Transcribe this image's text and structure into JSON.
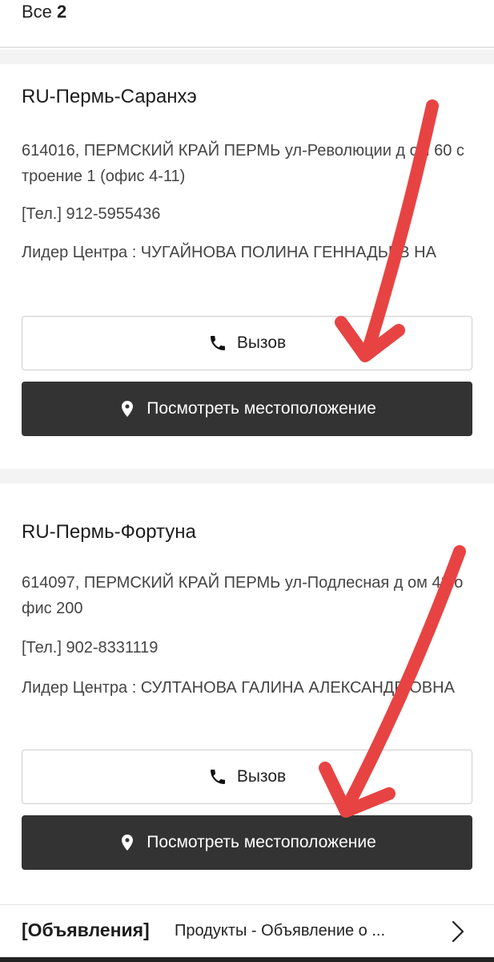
{
  "list_header": {
    "label": "Все",
    "count": "2"
  },
  "centers": [
    {
      "name": "RU-Пермь-Саранхэ",
      "address": "614016, ПЕРМСКИЙ КРАЙ ПЕРМЬ ул-Революции д ом 60 строение 1 (офис 4-11)",
      "phone": "[Тел.] 912-5955436",
      "leader": "Лидер Центра : ЧУГАЙНОВА ПОЛИНА ГЕННАДЬЕВ НА",
      "call_label": "Вызов",
      "location_label": "Посмотреть местоположение"
    },
    {
      "name": "RU-Пермь-Фортуна",
      "address": "614097, ПЕРМСКИЙ КРАЙ ПЕРМЬ ул-Подлесная д ом 43 офис 200",
      "phone": "[Тел.] 902-8331119",
      "leader": "Лидер Центра : СУЛТАНОВА ГАЛИНА АЛЕКСАНДР ОВНА",
      "call_label": "Вызов",
      "location_label": "Посмотреть местоположение"
    }
  ],
  "announcement": {
    "tag": "[Объявления]",
    "text": "Продукты - Объявление о ..."
  },
  "annotation_color": "#e84343",
  "icons": {
    "call": "phone-icon",
    "location": "map-pin-icon",
    "next": "chevron-right-icon"
  }
}
